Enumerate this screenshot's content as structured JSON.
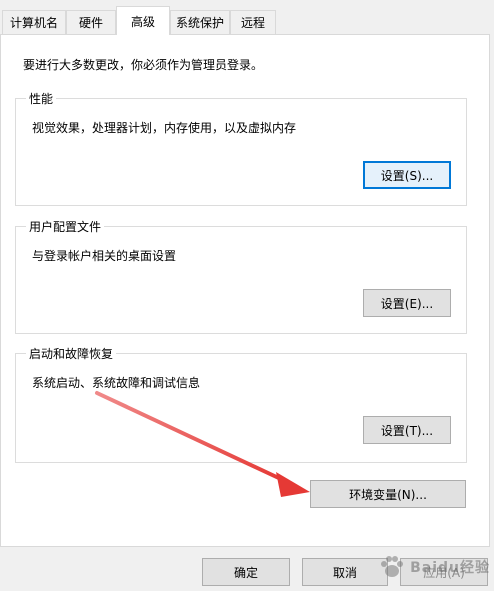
{
  "tabs": [
    {
      "label": "计算机名",
      "active": false
    },
    {
      "label": "硬件",
      "active": false
    },
    {
      "label": "高级",
      "active": true
    },
    {
      "label": "系统保护",
      "active": false
    },
    {
      "label": "远程",
      "active": false
    }
  ],
  "intro_text": "要进行大多数更改，你必须作为管理员登录。",
  "groups": {
    "performance": {
      "title": "性能",
      "description": "视觉效果，处理器计划，内存使用，以及虚拟内存",
      "button": "设置(S)..."
    },
    "user_profiles": {
      "title": "用户配置文件",
      "description": "与登录帐户相关的桌面设置",
      "button": "设置(E)..."
    },
    "startup_recovery": {
      "title": "启动和故障恢复",
      "description": "系统启动、系统故障和调试信息",
      "button": "设置(T)..."
    }
  },
  "env_button": "环境变量(N)...",
  "footer": {
    "ok": "确定",
    "cancel": "取消",
    "apply": "应用(A)"
  },
  "annotation": {
    "arrow_color": "#e53935"
  },
  "watermark": {
    "text": "Baidu经验"
  },
  "colors": {
    "window_bg": "#f0f0f0",
    "panel_bg": "#ffffff",
    "focus_blue": "#0078d7",
    "button_bg": "#e1e1e1"
  }
}
